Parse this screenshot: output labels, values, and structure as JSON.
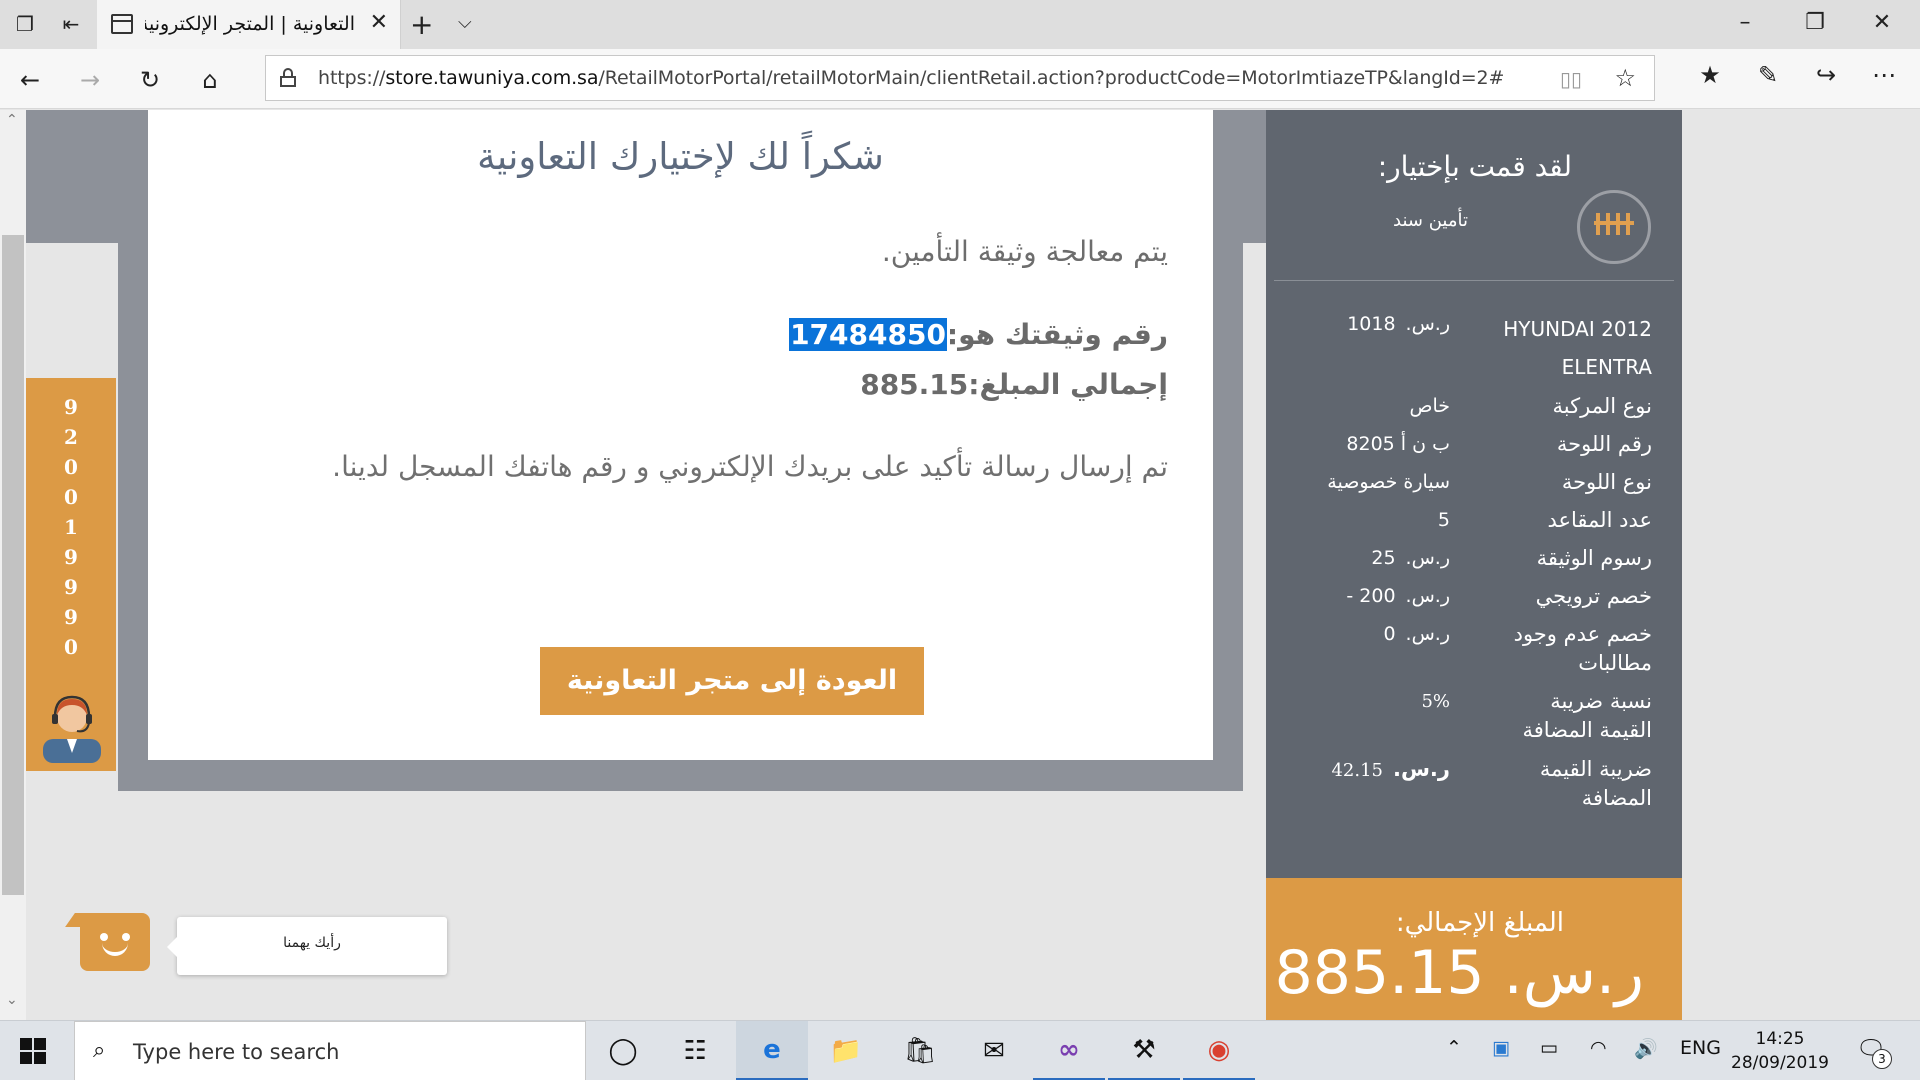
{
  "browser": {
    "tab_title": "التعاونية | المتجر الإلكترونية",
    "url_scheme": "https://",
    "url_host": "store.tawuniya.com.sa",
    "url_path": "/RetailMotorPortal/retailMotorMain/clientRetail.action?productCode=MotorImtiazeTP&langId=2#"
  },
  "main": {
    "heading": "شكراً لك لإختيارك التعاونية",
    "processing": "يتم معالجة وثيقة التأمين.",
    "policy_label": "رقم وثيقتك هو:",
    "policy_number": "17484850",
    "amount_label": "إجمالي المبلغ:",
    "amount_value": "885.15",
    "confirmation": "تم إرسال رسالة تأكيد على بريدك الإلكتروني و رقم هاتفك المسجل لدينا.",
    "back_button": "العودة إلى متجر التعاونية"
  },
  "phone": {
    "digits": [
      "9",
      "2",
      "0",
      "0",
      "1",
      "9",
      "9",
      "9",
      "0"
    ]
  },
  "summary": {
    "title": "لقد قمت بإختيار:",
    "product": "تأمين سند",
    "rows": [
      {
        "label": "HYUNDAI 2012 ELENTRA",
        "currency": "ر.س.",
        "value": "1018"
      },
      {
        "label": "نوع المركبة",
        "value": "خاص"
      },
      {
        "label": "رقم اللوحة",
        "value": "ب ن أ 8205"
      },
      {
        "label": "نوع اللوحة",
        "value": "سيارة خصوصية"
      },
      {
        "label": "عدد المقاعد",
        "value": "5"
      },
      {
        "label": "رسوم الوثيقة",
        "currency": "ر.س.",
        "value": "25"
      },
      {
        "label": "خصم ترويجي",
        "currency": "ر.س.",
        "value": "200 -"
      },
      {
        "label": "خصم عدم وجود مطالبات",
        "currency": "ر.س.",
        "value": "0"
      },
      {
        "label": "نسبة ضريبة القيمة المضافة",
        "value": "5%"
      },
      {
        "label": "ضريبة القيمة المضافة",
        "currency": "ر.س.",
        "value": "42.15"
      }
    ],
    "total_label": "المبلغ الإجمالي:",
    "total_value": "ر.س. 885.15"
  },
  "feedback": {
    "text": "رأيك يهمنا"
  },
  "taskbar": {
    "search_placeholder": "Type here to search",
    "language": "ENG",
    "time": "14:25",
    "date": "28/09/2019",
    "notification_count": "3"
  },
  "colors": {
    "accent_orange": "#dc9a45",
    "sidebar_gray": "#60666f",
    "frame_gray": "#8d9199",
    "heading_blue": "#5d6a7e",
    "selection_blue": "#0a73d9"
  }
}
